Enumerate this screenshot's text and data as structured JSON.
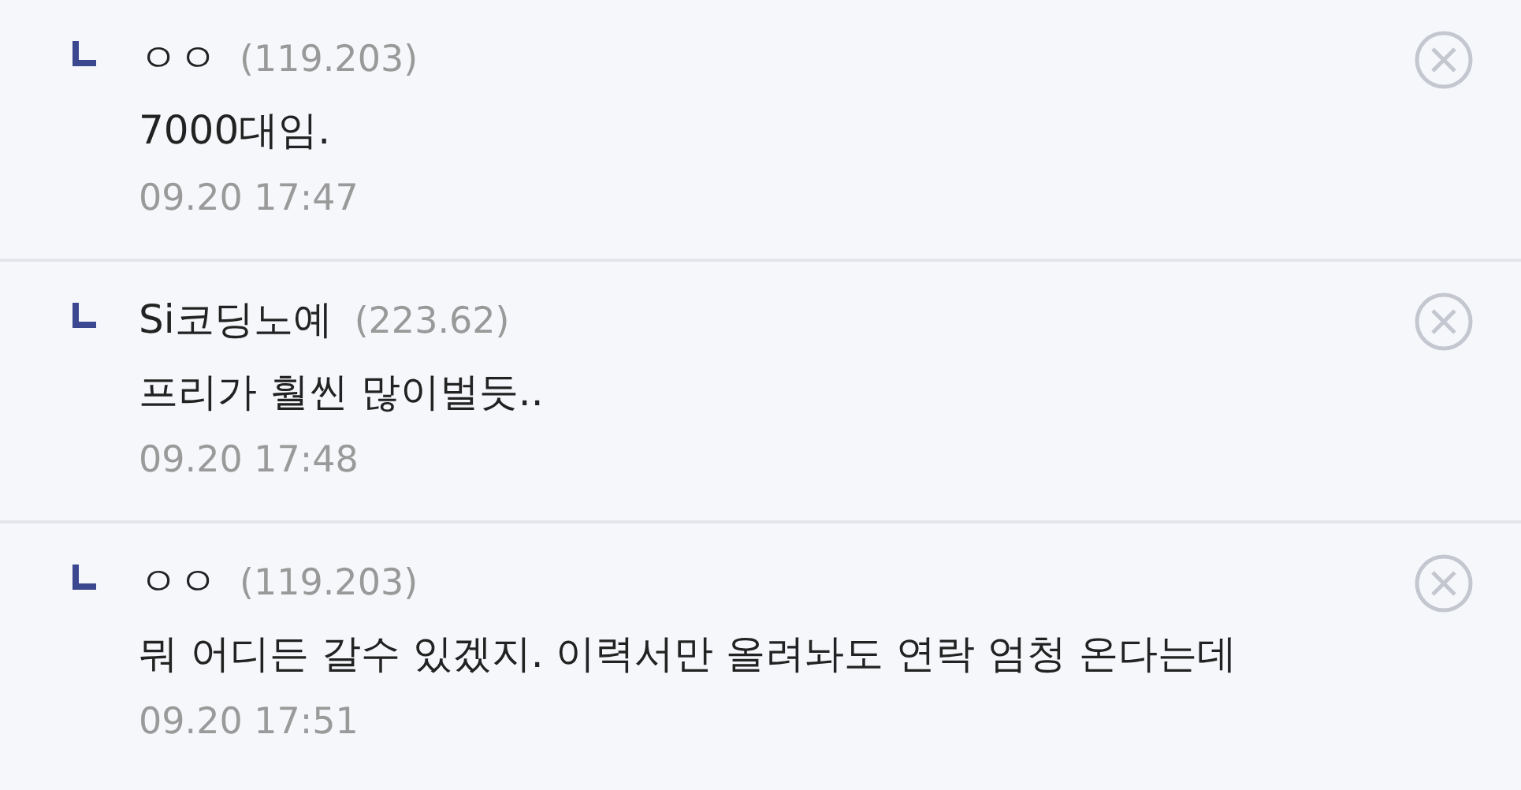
{
  "comments": [
    {
      "nickname": "ㅇㅇ",
      "ip": "(119.203)",
      "text": "7000대임.",
      "time": "09.20 17:47"
    },
    {
      "nickname": "Si코딩노예",
      "ip": "(223.62)",
      "text": "프리가 훨씬 많이벌듯..",
      "time": "09.20 17:48"
    },
    {
      "nickname": "ㅇㅇ",
      "ip": "(119.203)",
      "text": "뭐 어디든 갈수 있겠지. 이력서만 올려놔도 연락 엄청 온다는데",
      "time": "09.20 17:51"
    }
  ]
}
